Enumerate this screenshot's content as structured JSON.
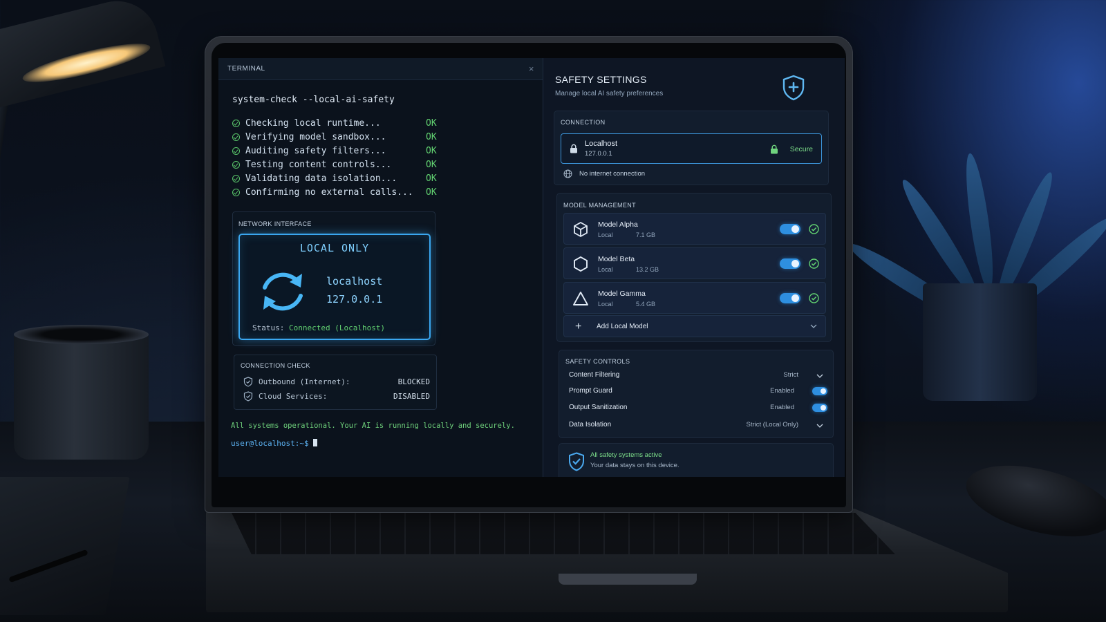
{
  "terminal": {
    "title": "TERMINAL",
    "close_symbol": "×",
    "command": "system-check --local-ai-safety",
    "checks": [
      {
        "label": "Checking local runtime...",
        "status": "OK"
      },
      {
        "label": "Verifying model sandbox...",
        "status": "OK"
      },
      {
        "label": "Auditing safety filters...",
        "status": "OK"
      },
      {
        "label": "Testing content controls...",
        "status": "OK"
      },
      {
        "label": "Validating data isolation...",
        "status": "OK"
      },
      {
        "label": "Confirming no external calls...",
        "status": "OK"
      }
    ],
    "network": {
      "heading": "NETWORK INTERFACE",
      "mode": "LOCAL ONLY",
      "host": "localhost",
      "ip": "127.0.0.1",
      "status_label": "Status:",
      "status_value": "Connected (Localhost)",
      "icon": "sync-icon"
    },
    "connection_check": {
      "heading": "CONNECTION CHECK",
      "rows": [
        {
          "label": "Outbound (Internet):",
          "status": "BLOCKED",
          "icon": "shield-icon"
        },
        {
          "label": "Cloud Services:",
          "status": "DISABLED",
          "icon": "shield-icon"
        }
      ]
    },
    "message": "All systems operational. Your AI is running locally and securely.",
    "prompt": "user@localhost:~$"
  },
  "settings": {
    "title": "SAFETY SETTINGS",
    "subtitle": "Manage local AI safety preferences",
    "header_icon": "shield-plus-icon",
    "connection": {
      "heading": "CONNECTION",
      "host_name": "Localhost",
      "host_ip": "127.0.0.1",
      "secure_label": "Secure",
      "no_internet": "No internet connection"
    },
    "models": {
      "heading": "MODEL MANAGEMENT",
      "items": [
        {
          "name": "Model Alpha",
          "location": "Local",
          "size": "7.1 GB",
          "enabled": true,
          "icon": "cube-icon"
        },
        {
          "name": "Model Beta",
          "location": "Local",
          "size": "13.2 GB",
          "enabled": true,
          "icon": "hexagon-icon"
        },
        {
          "name": "Model Gamma",
          "location": "Local",
          "size": "5.4 GB",
          "enabled": true,
          "icon": "triangle-icon"
        }
      ],
      "add_label": "Add Local Model"
    },
    "controls": {
      "heading": "SAFETY CONTROLS",
      "rows": [
        {
          "label": "Content Filtering",
          "value": "Strict",
          "kind": "dropdown"
        },
        {
          "label": "Prompt Guard",
          "value": "Enabled",
          "kind": "toggle"
        },
        {
          "label": "Output Sanitization",
          "value": "Enabled",
          "kind": "toggle"
        },
        {
          "label": "Data Isolation",
          "value": "Strict (Local Only)",
          "kind": "dropdown"
        }
      ]
    },
    "footer": {
      "title": "All safety systems active",
      "subtitle": "Your data stays on this device."
    }
  },
  "colors": {
    "accent": "#3aa7f0",
    "ok_green": "#62d271",
    "panel": "#121d2d"
  }
}
